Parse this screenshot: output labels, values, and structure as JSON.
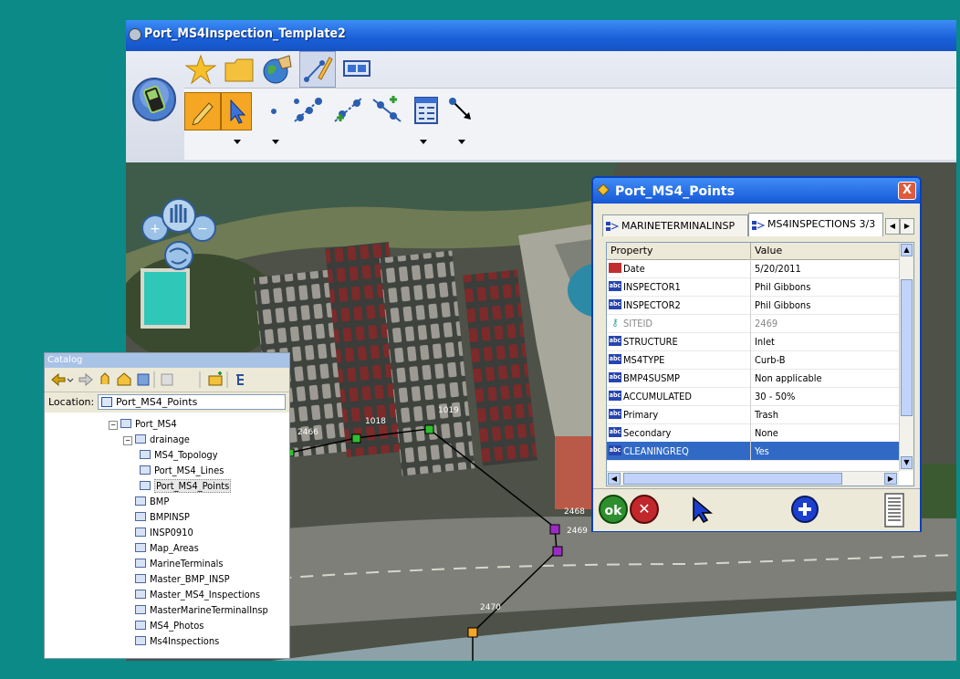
{
  "window": {
    "title": "Port_MS4Inspection_Template2"
  },
  "ribbon": {
    "tabs": [
      "favorites-icon",
      "folder-icon",
      "globe-icon",
      "edit-tools-icon",
      "layout-icon"
    ],
    "tools": [
      "pencil-icon",
      "select-arrow-icon",
      "point-icon",
      "vertices-icon",
      "add-vertex-icon",
      "edit-line-icon",
      "attributes-icon",
      "connect-icon"
    ]
  },
  "map": {
    "labels": [
      "2466",
      "1018",
      "1019",
      "2468",
      "2469",
      "2470"
    ]
  },
  "popup": {
    "title": "Port_MS4_Points",
    "close_label": "X",
    "tabs": [
      "MARINETERMINALINSP",
      "MS4INSPECTIONS 3/3"
    ],
    "header_property": "Property",
    "header_value": "Value",
    "rows": [
      {
        "property": "Date",
        "value": "5/20/2011",
        "icon": "date-icon"
      },
      {
        "property": "INSPECTOR1",
        "value": "Phil Gibbons",
        "icon": "text-field-icon"
      },
      {
        "property": "INSPECTOR2",
        "value": "Phil Gibbons",
        "icon": "text-field-icon"
      },
      {
        "property": "SITEID",
        "value": "2469",
        "icon": "key-icon"
      },
      {
        "property": "STRUCTURE",
        "value": "Inlet",
        "icon": "text-field-icon"
      },
      {
        "property": "MS4TYPE",
        "value": "Curb-B",
        "icon": "text-field-icon"
      },
      {
        "property": "BMP4SUSMP",
        "value": "Non applicable",
        "icon": "text-field-icon"
      },
      {
        "property": "ACCUMULATED",
        "value": "30 - 50%",
        "icon": "text-field-icon"
      },
      {
        "property": "Primary",
        "value": "Trash",
        "icon": "text-field-icon"
      },
      {
        "property": "Secondary",
        "value": "None",
        "icon": "text-field-icon"
      },
      {
        "property": "CLEANINGREQ",
        "value": "Yes",
        "icon": "text-field-icon"
      }
    ],
    "ok_label": "ok",
    "cancel_label": "✕",
    "icon_text_abc": "abc"
  },
  "catalog": {
    "title": "Catalog",
    "location_label": "Location:",
    "location_value": "Port_MS4_Points",
    "tree": [
      {
        "label": "Port_MS4",
        "indent": 0
      },
      {
        "label": "drainage",
        "indent": 1
      },
      {
        "label": "MS4_Topology",
        "indent": 2
      },
      {
        "label": "Port_MS4_Lines",
        "indent": 2
      },
      {
        "label": "Port_MS4_Points",
        "indent": 2
      },
      {
        "label": "BMP",
        "indent": 1
      },
      {
        "label": "BMPINSP",
        "indent": 1
      },
      {
        "label": "INSP0910",
        "indent": 1
      },
      {
        "label": "Map_Areas",
        "indent": 1
      },
      {
        "label": "MarineTerminals",
        "indent": 1
      },
      {
        "label": "Master_BMP_INSP",
        "indent": 1
      },
      {
        "label": "Master_MS4_Inspections",
        "indent": 1
      },
      {
        "label": "MasterMarineTerminalInsp",
        "indent": 1
      },
      {
        "label": "MS4_Photos",
        "indent": 1
      },
      {
        "label": "Ms4Inspections",
        "indent": 1
      }
    ]
  }
}
